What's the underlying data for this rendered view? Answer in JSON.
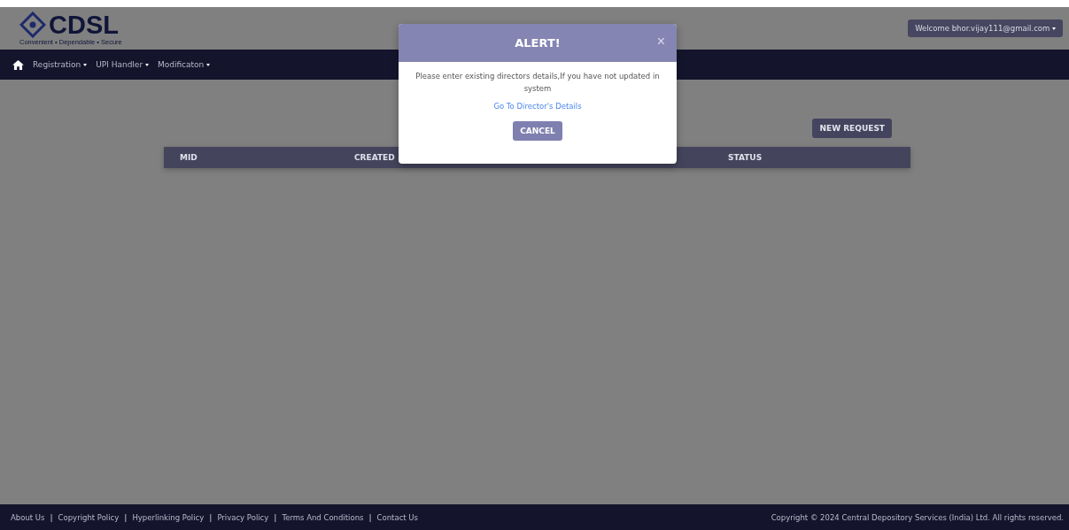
{
  "header": {
    "logo_text": "CDSL",
    "tagline": "Convenient • Dependable • Secure",
    "user_menu": "Welcome bhor.vijay111@gmail.com"
  },
  "nav": {
    "items": [
      {
        "label": "Registration"
      },
      {
        "label": "UPI Handler"
      },
      {
        "label": "Modificaton"
      }
    ]
  },
  "new_request_button": "NEW REQUEST",
  "table": {
    "columns": [
      "MID",
      "CREATED",
      "STATUS"
    ]
  },
  "modal": {
    "title": "ALERT!",
    "close": "×",
    "message": "Please enter existing directors details,If you have not updated in system",
    "link": "Go To Director's Details",
    "button": "CANCEL"
  },
  "footer": {
    "separator": "|",
    "links": [
      "About Us",
      "Copyright Policy",
      "Hyperlinking Policy",
      "Privacy Policy",
      "Terms And Conditions",
      "Contact Us"
    ],
    "copyright": "Copyright © 2024 Central Depository Services (India) Ltd. All rights reserved."
  }
}
